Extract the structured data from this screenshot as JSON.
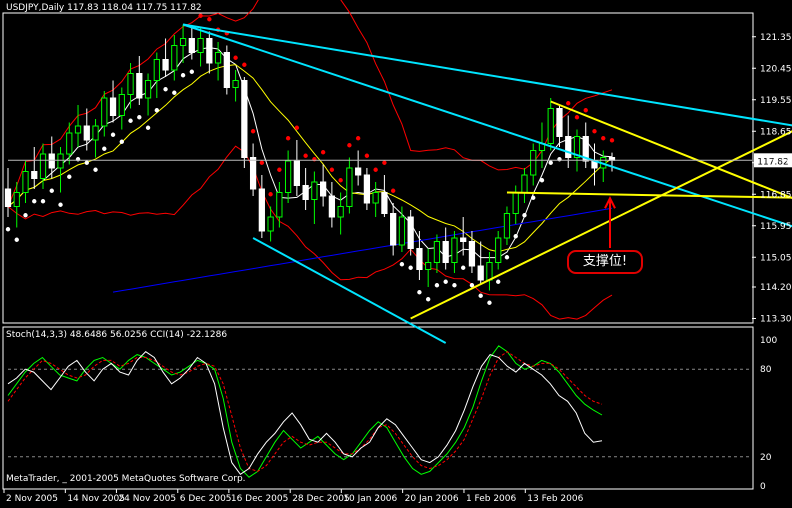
{
  "header": {
    "main_title": "USDJPY,Daily  117.83 118.04 117.75 117.82",
    "stoch_title": "Stoch(14,3,3) 48.6486 56.0256  CCI(14) -22.1286",
    "footer": "MetaTrader, _ 2001-2005 MetaQuotes Software Corp."
  },
  "annotation": {
    "text": "支撑位!",
    "color": "#ff0000"
  },
  "current_price_label": "117.82",
  "colors": {
    "background": "#000000",
    "axis": "#ffffff",
    "candle_up": "#000000",
    "candle_down": "#ffffff",
    "bull_body": "#00ff00",
    "trendline_cyan": "#00e5ff",
    "trendline_yellow": "#ffff00",
    "bollinger": "#ff0000",
    "ma_fast": "#ffffff",
    "ma_slow": "#ffff00",
    "ma_long": "#0000ff",
    "sar_bull": "#ffffff",
    "sar_bear": "#ff0000",
    "stoch_main": "#00ff00",
    "stoch_signal": "#ff0000",
    "cci": "#ffffff"
  },
  "chart_data": [
    {
      "type": "candlestick",
      "symbol": "USDJPY",
      "timeframe": "Daily",
      "ohlc_last": {
        "open": 117.83,
        "high": 118.04,
        "low": 117.75,
        "close": 117.82
      },
      "ylim": [
        113.2,
        122.0
      ],
      "y_ticks": [
        "121.35",
        "120.45",
        "119.55",
        "118.65",
        "117.75",
        "116.85",
        "115.95",
        "115.05",
        "114.20",
        "113.30"
      ],
      "x_ticks": [
        "2 Nov 2005",
        "14 Nov 2005",
        "24 Nov 2005",
        "6 Dec 2005",
        "16 Dec 2005",
        "28 Dec 2005",
        "10 Jan 2006",
        "20 Jan 2006",
        "1 Feb 2006",
        "13 Feb 2006"
      ],
      "current_price": 117.82,
      "candles": [
        [
          117.0,
          117.6,
          116.2,
          116.5
        ],
        [
          116.5,
          117.2,
          115.9,
          116.9
        ],
        [
          116.9,
          117.8,
          116.6,
          117.5
        ],
        [
          117.5,
          118.2,
          117.0,
          117.3
        ],
        [
          117.3,
          118.3,
          117.0,
          118.0
        ],
        [
          118.0,
          118.5,
          117.3,
          117.6
        ],
        [
          117.6,
          118.2,
          116.9,
          118.0
        ],
        [
          118.0,
          118.9,
          117.7,
          118.6
        ],
        [
          118.6,
          119.4,
          118.2,
          118.8
        ],
        [
          118.8,
          119.3,
          118.1,
          118.4
        ],
        [
          118.4,
          119.0,
          117.9,
          118.8
        ],
        [
          118.8,
          119.8,
          118.5,
          119.6
        ],
        [
          119.6,
          120.1,
          118.9,
          119.1
        ],
        [
          119.1,
          119.9,
          118.7,
          119.7
        ],
        [
          119.7,
          120.6,
          119.3,
          120.3
        ],
        [
          120.3,
          120.8,
          119.4,
          119.6
        ],
        [
          119.6,
          120.3,
          119.1,
          120.1
        ],
        [
          120.1,
          120.9,
          119.6,
          120.7
        ],
        [
          120.7,
          121.3,
          120.2,
          120.4
        ],
        [
          120.4,
          121.4,
          120.1,
          121.1
        ],
        [
          121.1,
          121.7,
          120.6,
          121.3
        ],
        [
          121.3,
          121.6,
          120.7,
          120.9
        ],
        [
          120.9,
          121.6,
          120.5,
          121.3
        ],
        [
          121.3,
          121.5,
          120.3,
          120.6
        ],
        [
          120.6,
          121.2,
          120.1,
          120.9
        ],
        [
          120.9,
          121.1,
          119.7,
          119.9
        ],
        [
          119.9,
          120.4,
          119.5,
          120.1
        ],
        [
          120.1,
          120.2,
          117.6,
          117.9
        ],
        [
          117.9,
          118.3,
          116.8,
          117.0
        ],
        [
          117.0,
          117.4,
          115.6,
          115.8
        ],
        [
          115.8,
          116.5,
          115.5,
          116.2
        ],
        [
          116.2,
          117.2,
          115.9,
          116.9
        ],
        [
          116.9,
          118.1,
          116.6,
          117.8
        ],
        [
          117.8,
          118.4,
          116.8,
          117.1
        ],
        [
          117.1,
          117.6,
          116.4,
          116.7
        ],
        [
          116.7,
          117.5,
          116.0,
          117.2
        ],
        [
          117.2,
          117.7,
          116.5,
          116.8
        ],
        [
          116.8,
          117.2,
          115.9,
          116.2
        ],
        [
          116.2,
          116.9,
          115.7,
          116.5
        ],
        [
          116.5,
          117.9,
          116.3,
          117.6
        ],
        [
          117.6,
          118.1,
          117.1,
          117.4
        ],
        [
          117.4,
          117.6,
          116.4,
          116.6
        ],
        [
          116.6,
          117.2,
          116.2,
          116.9
        ],
        [
          116.9,
          117.4,
          116.2,
          116.3
        ],
        [
          116.3,
          116.6,
          115.1,
          115.4
        ],
        [
          115.4,
          116.5,
          115.2,
          116.2
        ],
        [
          116.2,
          116.4,
          115.1,
          115.3
        ],
        [
          115.3,
          115.8,
          114.4,
          114.7
        ],
        [
          114.7,
          115.3,
          114.2,
          114.9
        ],
        [
          114.9,
          115.7,
          114.6,
          115.5
        ],
        [
          115.5,
          115.9,
          114.7,
          114.9
        ],
        [
          114.9,
          115.8,
          114.6,
          115.6
        ],
        [
          115.6,
          116.2,
          115.1,
          115.5
        ],
        [
          115.5,
          115.8,
          114.6,
          114.8
        ],
        [
          114.8,
          115.5,
          114.3,
          114.4
        ],
        [
          114.4,
          115.2,
          114.1,
          114.9
        ],
        [
          114.9,
          115.8,
          114.7,
          115.6
        ],
        [
          115.6,
          116.5,
          115.4,
          116.3
        ],
        [
          116.3,
          117.1,
          116.0,
          116.9
        ],
        [
          116.9,
          117.6,
          116.6,
          117.4
        ],
        [
          117.4,
          118.3,
          117.1,
          118.1
        ],
        [
          118.1,
          118.9,
          117.6,
          118.3
        ],
        [
          118.3,
          119.6,
          118.1,
          119.3
        ],
        [
          119.3,
          119.4,
          118.2,
          118.5
        ],
        [
          118.5,
          119.1,
          117.6,
          117.9
        ],
        [
          117.9,
          118.7,
          117.5,
          118.5
        ],
        [
          118.5,
          118.9,
          117.6,
          117.8
        ],
        [
          117.8,
          118.3,
          117.1,
          117.6
        ],
        [
          117.6,
          118.1,
          117.2,
          117.9
        ],
        [
          117.9,
          118.04,
          117.5,
          117.82
        ]
      ],
      "indicators": {
        "bollinger": "red",
        "moving_averages": [
          "white",
          "yellow",
          "blue"
        ],
        "parabolic_sar": {
          "bull": "white",
          "bear": "red"
        }
      }
    },
    {
      "type": "line",
      "title": "Stoch(14,3,3) 48.6486 56.0256  CCI(14) -22.1286",
      "ylim": [
        0,
        100
      ],
      "y_ticks": [
        "100",
        "80",
        "20",
        "0"
      ],
      "levels": [
        80,
        20
      ],
      "series": [
        {
          "name": "Stoch(14,3,3)",
          "color": "#00ff00",
          "values": [
            62,
            70,
            78,
            84,
            88,
            82,
            76,
            74,
            72,
            80,
            86,
            88,
            84,
            80,
            86,
            90,
            88,
            84,
            80,
            76,
            78,
            82,
            86,
            84,
            80,
            60,
            30,
            12,
            6,
            10,
            20,
            30,
            38,
            32,
            26,
            30,
            34,
            28,
            22,
            18,
            22,
            30,
            38,
            44,
            40,
            30,
            20,
            12,
            8,
            10,
            16,
            22,
            30,
            40,
            54,
            72,
            88,
            96,
            92,
            84,
            80,
            82,
            86,
            84,
            78,
            70,
            62,
            56,
            52,
            48.6486
          ]
        },
        {
          "name": "",
          "color": "#ff0000",
          "values": [
            58,
            66,
            74,
            80,
            86,
            84,
            80,
            76,
            74,
            76,
            82,
            86,
            86,
            82,
            84,
            88,
            88,
            86,
            82,
            78,
            76,
            78,
            82,
            84,
            82,
            70,
            48,
            26,
            12,
            10,
            14,
            22,
            30,
            34,
            30,
            28,
            30,
            30,
            26,
            22,
            22,
            26,
            32,
            40,
            42,
            36,
            28,
            20,
            14,
            12,
            14,
            18,
            24,
            32,
            46,
            60,
            76,
            88,
            92,
            88,
            84,
            82,
            84,
            84,
            80,
            74,
            68,
            62,
            58,
            56.0256
          ]
        },
        {
          "name": "CCI(14)",
          "color": "#ffffff",
          "values": [
            70,
            74,
            80,
            78,
            72,
            66,
            74,
            82,
            86,
            78,
            72,
            80,
            84,
            78,
            76,
            86,
            92,
            88,
            78,
            70,
            74,
            80,
            88,
            84,
            70,
            40,
            16,
            8,
            12,
            22,
            30,
            36,
            44,
            50,
            42,
            32,
            30,
            36,
            30,
            22,
            20,
            26,
            30,
            40,
            46,
            42,
            34,
            26,
            18,
            16,
            20,
            28,
            38,
            52,
            68,
            82,
            90,
            88,
            82,
            78,
            84,
            80,
            76,
            70,
            62,
            58,
            50,
            36,
            30,
            31
          ]
        }
      ]
    }
  ]
}
